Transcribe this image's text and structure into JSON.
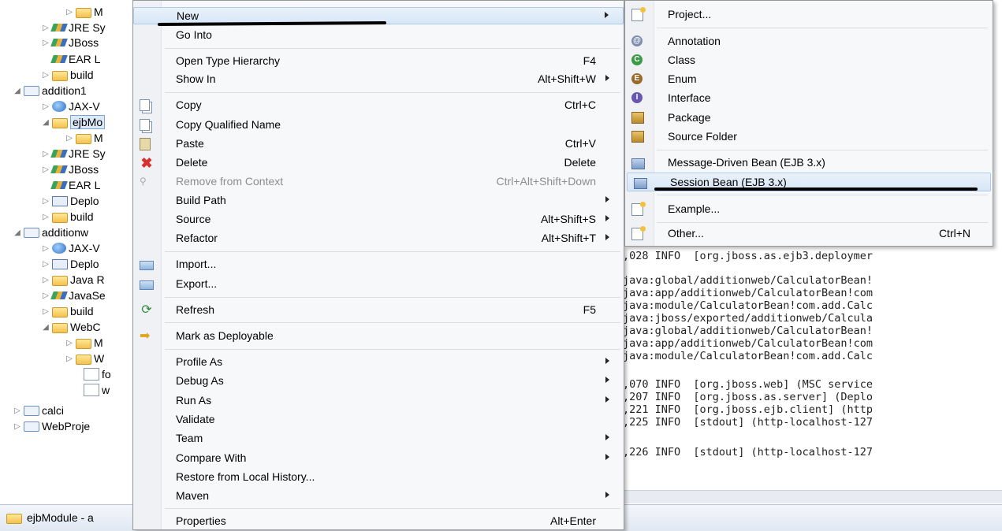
{
  "tree": {
    "rows": [
      {
        "label": "M",
        "twisty": "▷"
      },
      {
        "label": "JRE Sy",
        "twisty": "▷"
      },
      {
        "label": "JBoss",
        "twisty": "▷"
      },
      {
        "label": "EAR L",
        "twisty": ""
      },
      {
        "label": "build",
        "twisty": "▷"
      },
      {
        "label": "addition1",
        "twisty": "◢"
      },
      {
        "label": "JAX-V",
        "twisty": "▷"
      },
      {
        "label": "ejbMo",
        "twisty": "◢"
      },
      {
        "label": "M",
        "twisty": "▷"
      },
      {
        "label": "JRE Sy",
        "twisty": "▷"
      },
      {
        "label": "JBoss",
        "twisty": "▷"
      },
      {
        "label": "EAR L",
        "twisty": ""
      },
      {
        "label": "Deplo",
        "twisty": "▷"
      },
      {
        "label": "build",
        "twisty": "▷"
      },
      {
        "label": "additionw",
        "twisty": "◢"
      },
      {
        "label": "JAX-V",
        "twisty": "▷"
      },
      {
        "label": "Deplo",
        "twisty": "▷"
      },
      {
        "label": "Java R",
        "twisty": "▷"
      },
      {
        "label": "JavaSe",
        "twisty": "▷"
      },
      {
        "label": "build",
        "twisty": "▷"
      },
      {
        "label": "WebC",
        "twisty": "◢"
      },
      {
        "label": "M",
        "twisty": "▷"
      },
      {
        "label": "W",
        "twisty": "▷"
      },
      {
        "label": "fo",
        "twisty": ""
      },
      {
        "label": "w",
        "twisty": ""
      },
      {
        "label": "calci",
        "twisty": "▷"
      },
      {
        "label": "WebProje",
        "twisty": "▷"
      }
    ]
  },
  "menu": {
    "items": [
      {
        "label": "New",
        "shortcut": "",
        "submenu": true
      },
      {
        "label": "Go Into",
        "shortcut": ""
      },
      {
        "label": "Open Type Hierarchy",
        "shortcut": "F4"
      },
      {
        "label": "Show In",
        "shortcut": "Alt+Shift+W",
        "submenu": true
      },
      {
        "label": "Copy",
        "shortcut": "Ctrl+C"
      },
      {
        "label": "Copy Qualified Name",
        "shortcut": ""
      },
      {
        "label": "Paste",
        "shortcut": "Ctrl+V"
      },
      {
        "label": "Delete",
        "shortcut": "Delete"
      },
      {
        "label": "Remove from Context",
        "shortcut": "Ctrl+Alt+Shift+Down"
      },
      {
        "label": "Build Path",
        "shortcut": "",
        "submenu": true
      },
      {
        "label": "Source",
        "shortcut": "Alt+Shift+S",
        "submenu": true
      },
      {
        "label": "Refactor",
        "shortcut": "Alt+Shift+T",
        "submenu": true
      },
      {
        "label": "Import...",
        "shortcut": ""
      },
      {
        "label": "Export...",
        "shortcut": ""
      },
      {
        "label": "Refresh",
        "shortcut": "F5"
      },
      {
        "label": "Mark as Deployable",
        "shortcut": ""
      },
      {
        "label": "Profile As",
        "shortcut": "",
        "submenu": true
      },
      {
        "label": "Debug As",
        "shortcut": "",
        "submenu": true
      },
      {
        "label": "Run As",
        "shortcut": "",
        "submenu": true
      },
      {
        "label": "Validate",
        "shortcut": ""
      },
      {
        "label": "Team",
        "shortcut": "",
        "submenu": true
      },
      {
        "label": "Compare With",
        "shortcut": "",
        "submenu": true
      },
      {
        "label": "Restore from Local History...",
        "shortcut": ""
      },
      {
        "label": "Maven",
        "shortcut": "",
        "submenu": true
      },
      {
        "label": "Properties",
        "shortcut": "Alt+Enter"
      }
    ]
  },
  "submenu": {
    "items": [
      {
        "label": "Project...",
        "shortcut": ""
      },
      {
        "label": "Annotation",
        "shortcut": ""
      },
      {
        "label": "Class",
        "shortcut": ""
      },
      {
        "label": "Enum",
        "shortcut": ""
      },
      {
        "label": "Interface",
        "shortcut": ""
      },
      {
        "label": "Package",
        "shortcut": ""
      },
      {
        "label": "Source Folder",
        "shortcut": ""
      },
      {
        "label": "Message-Driven Bean (EJB 3.x)",
        "shortcut": ""
      },
      {
        "label": "Session Bean (EJB 3.x)",
        "shortcut": ""
      },
      {
        "label": "Example...",
        "shortcut": ""
      },
      {
        "label": "Other...",
        "shortcut": "Ctrl+N"
      }
    ]
  },
  "console": {
    "lines": [
      ",028 INFO  [org.jboss.as.ejb3.deploymer",
      "java:global/additionweb/CalculatorBean!",
      "java:app/additionweb/CalculatorBean!com",
      "java:module/CalculatorBean!com.add.Calc",
      "java:jboss/exported/additionweb/Calcula",
      "java:global/additionweb/CalculatorBean!",
      "java:app/additionweb/CalculatorBean!com",
      "java:module/CalculatorBean!com.add.Calc",
      ",070 INFO  [org.jboss.web] (MSC service",
      ",207 INFO  [org.jboss.as.server] (Deplo",
      ",221 INFO  [org.jboss.ejb.client] (http",
      ",225 INFO  [stdout] (http-localhost-127",
      ",226 INFO  [stdout] (http-localhost-127"
    ]
  },
  "status": {
    "text": "ejbModule - a"
  }
}
